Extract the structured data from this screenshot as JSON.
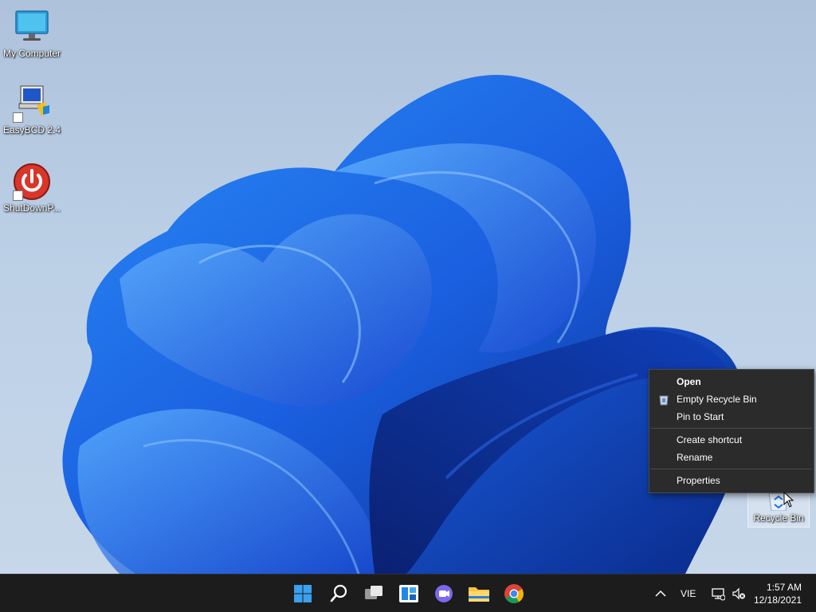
{
  "desktop": {
    "icons": [
      {
        "label": "My Computer"
      },
      {
        "label": "EasyBCD 2.4"
      },
      {
        "label": "ShutDownP..."
      },
      {
        "label": "Recycle Bin"
      }
    ]
  },
  "context_menu": {
    "items": [
      "Open",
      "Empty Recycle Bin",
      "Pin to Start",
      "Create shortcut",
      "Rename",
      "Properties"
    ]
  },
  "taskbar": {
    "pinned": [
      "start-icon",
      "search-icon",
      "task-view-icon",
      "widgets-icon",
      "chat-icon",
      "file-explorer-icon",
      "chrome-icon"
    ],
    "tray": {
      "language": "VIE",
      "time": "1:57 AM",
      "date": "12/18/2021"
    }
  },
  "colors": {
    "accent": "#1a73e8",
    "taskbar": "#1c1c1c",
    "menu": "#2b2b2b"
  }
}
